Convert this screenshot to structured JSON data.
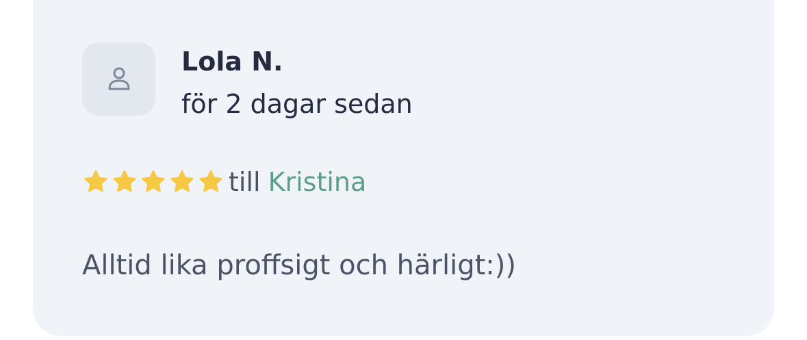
{
  "review": {
    "author": "Lola N.",
    "time_ago": "för 2 dagar sedan",
    "rating": 5,
    "rating_max": 5,
    "to_prefix": "till",
    "recipient": "Kristina",
    "text": "Alltid lika proffsigt och härligt:))",
    "avatar_icon": "user-icon",
    "star_icon": "star-icon"
  },
  "colors": {
    "card_background": "#f0f4f8",
    "avatar_background": "#e3e8ef",
    "star": "#f6c945",
    "recipient_link": "#5e9e89",
    "name_text": "#262b3f",
    "body_text": "#4b5365"
  }
}
